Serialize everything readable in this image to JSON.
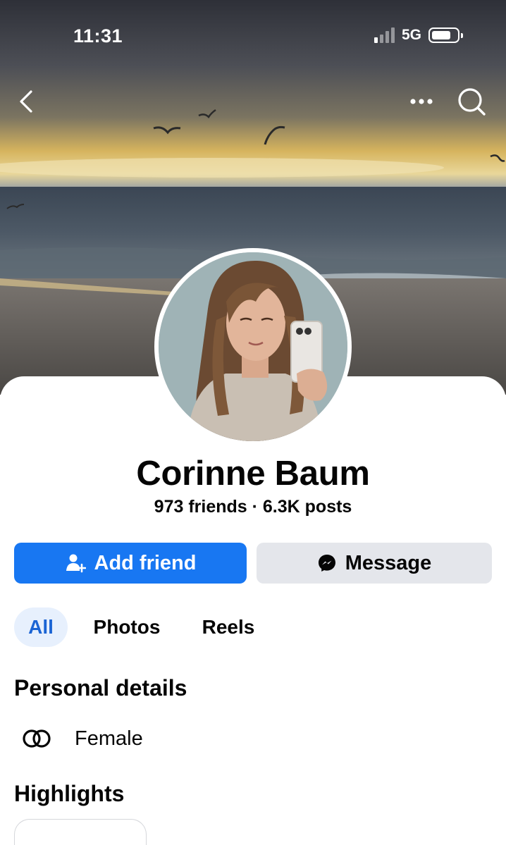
{
  "status_bar": {
    "time": "11:31",
    "network": "5G",
    "signal_bars_active": 1,
    "battery_level": 0.7
  },
  "navigation": {
    "back_icon": "chevron-left-icon",
    "more_icon": "more-horizontal-icon",
    "search_icon": "search-icon"
  },
  "profile": {
    "name": "Corinne Baum",
    "stats": "973 friends · 6.3K posts"
  },
  "actions": {
    "add_friend_label": "Add friend",
    "add_friend_icon": "add-person-icon",
    "message_label": "Message",
    "message_icon": "messenger-icon"
  },
  "tabs": [
    {
      "label": "All",
      "selected": true
    },
    {
      "label": "Photos",
      "selected": false
    },
    {
      "label": "Reels",
      "selected": false
    }
  ],
  "personal_details": {
    "title": "Personal details",
    "items": [
      {
        "icon": "gender-rings-icon",
        "label": "Female"
      }
    ]
  },
  "highlights": {
    "title": "Highlights"
  },
  "colors": {
    "primary_blue": "#1877f2",
    "secondary_button": "#e4e6eb",
    "selected_tab_bg": "#e7f0fd",
    "selected_tab_text": "#1b64d4"
  }
}
